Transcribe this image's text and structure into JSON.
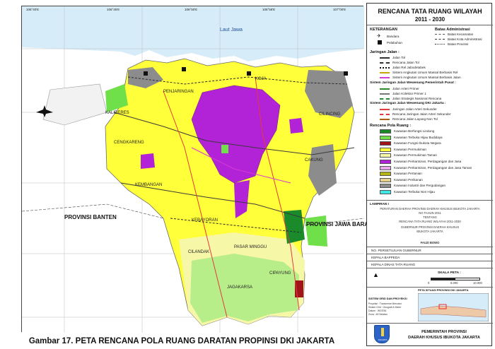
{
  "map": {
    "sea_label": "Laut Jawa",
    "region_west": "PROVINSI BANTEN",
    "region_east": "PROVINSI JAWA BARAT",
    "coord_labels": [
      "106°40'E",
      "106°45'E",
      "106°50'E",
      "106°55'E",
      "107°00'E"
    ],
    "place_labels": [
      "KALIDERES",
      "PENJARINGAN",
      "CENGKARENG",
      "KEMBANGAN",
      "KEBAYORAN",
      "CILANDAK",
      "PASAR MINGGU",
      "JAGAKARSA",
      "CIPAYUNG",
      "CAKUNG",
      "CILINCING",
      "KOJA"
    ]
  },
  "caption": "Gambar 17. PETA RENCANA POLA RUANG DARATAN PROPINSI DKI JAKARTA",
  "panel": {
    "title": "RENCANA TATA RUANG WILAYAH",
    "years": "2011 - 2030",
    "keterangan_title": "KETERANGAN",
    "icons": [
      {
        "label": "Bandara"
      },
      {
        "label": "Pelabuhan"
      }
    ],
    "batas_title": "Batas Administrasi",
    "batas": [
      "Batas Kecamatan",
      "Batas Kota Administrasi",
      "Batas Provinsi"
    ],
    "jaringan_title": "Jaringan Jalan :",
    "jaringan": [
      "Jalan Tol",
      "Rencana Jalan Tol",
      "Jalan Rel Jabodetabek",
      "Sistem Angkutan Umum Massal Berbasis Rel",
      "Sistem Angkutan Umum Massal Berbasis Jalan"
    ],
    "sistem_pusat_title": "Sistem Jaringan Jalan Wewenang Pemerintah Pusat :",
    "sistem_pusat": [
      "Jalan Arteri Primer",
      "Jalan Kolektor Primer 1",
      "Jalan Strategis Nasional Rencana"
    ],
    "sistem_dki_title": "Sistem Jaringan Jalan Wewenang DKI Jakarta :",
    "sistem_dki": [
      "Jaringan Jalan Arteri Sekunder",
      "Rencana Jaringan Jalan Arteri Sekunder",
      "Rencana Jalan Layang Non Tol"
    ],
    "pola_title": "Rencana Pola Ruang :",
    "pola": [
      {
        "label": "Kawasan Berfungsi Lindung",
        "color": "#1a8a2a"
      },
      {
        "label": "Kawasan Terbuka Hijau Budidaya",
        "color": "#6fe04a"
      },
      {
        "label": "Kawasan Fungsi Ibukota Negara",
        "color": "#a3141a"
      },
      {
        "label": "Kawasan Permukiman",
        "color": "#ffff3a"
      },
      {
        "label": "Kawasan Permukiman Taman",
        "color": "#f7f7a8"
      },
      {
        "label": "Kawasan Perkantoran, Perdagangan dan Jasa",
        "color": "#b222d6"
      },
      {
        "label": "Kawasan Perkantoran, Perdagangan dan Jasa Taman",
        "color": "#e8a9e8"
      },
      {
        "label": "Kawasan Pertanian",
        "color": "#b4b414"
      },
      {
        "label": "Kawasan Perikanan",
        "color": "#e6d28c"
      },
      {
        "label": "Kawasan Industri dan Pergudangan",
        "color": "#8c8c8c"
      },
      {
        "label": "Kawasan Terbuka Non Hijau",
        "color": "#3ee8e8"
      }
    ],
    "lampiran_title": "LAMPIRAN I",
    "lampiran_lines": [
      "PERATURAN DAERAH PROVINSI DAERAH KHUSUS IBUKOTA JAKARTA",
      "NO   TAHUN 2011",
      "TENTANG",
      "RENCANA TATA RUANG WILAYAH 2011-2030"
    ],
    "gubernur_lines": [
      "GUBERNUR PROVINSI DAERAH KHUSUS",
      "IBUKOTA JAKARTA"
    ],
    "gubernur_name": "FAUZI BOWO",
    "sign_rows": [
      "NO. PERSETUJUAN GUBERNUR",
      "KEPALA BAPPEDA",
      "KEPALA DINAS TATA RUANG"
    ],
    "skala_title": "SKALA PETA :",
    "scale_ticks": [
      "0",
      "5.000",
      "10.000"
    ],
    "index_title": "PETA SITUASI PROVINSI DKI JAKARTA",
    "sistem_grid": "SISTEM GRID DAN PROYEKSI",
    "proj_lines": [
      "Proyeksi   : Transverse Mercator",
      "Sistem Grid : Geografi & Meter",
      "Datum      : WGS'84",
      "Zona       : 48 Selatan"
    ],
    "org_lines": [
      "PEMERINTAH PROVINSI",
      "DAERAH KHUSUS IBUKOTA JAKARTA"
    ],
    "jakarta_logo_text": "JAKARTA"
  }
}
